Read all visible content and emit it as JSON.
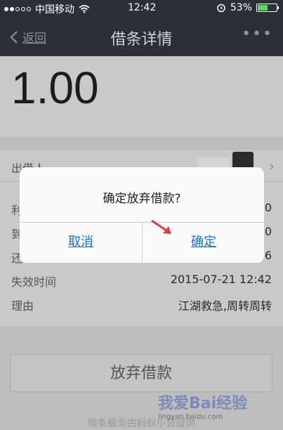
{
  "status_bar": {
    "carrier": "中国移动",
    "time": "12:42",
    "battery_percent": "53%",
    "battery_level": 0.53
  },
  "nav": {
    "back_label": "返回",
    "title": "借条详情"
  },
  "amount": "1.00",
  "details": {
    "lender_label": "出借人",
    "rows": [
      {
        "label": "利",
        "value": "0"
      },
      {
        "label": "到",
        "value": "0"
      },
      {
        "label": "还",
        "value": "6"
      },
      {
        "label": "失效时间",
        "value": "2015-07-21 12:42"
      },
      {
        "label": "理由",
        "value": "江湖救急,周转周转"
      }
    ]
  },
  "give_up_button": "放弃借款",
  "footer_note": "借条服务由蚂蚁小贷提供",
  "dialog": {
    "message": "确定放弃借款?",
    "cancel_label": "取消",
    "confirm_label": "确定"
  },
  "watermark": {
    "text": "我爱Bai经验",
    "sub": "jingyan.baidu.com"
  },
  "colors": {
    "nav_bg": "#2c2f38",
    "link_blue": "#1a6fd8",
    "arrow_red": "#e23b3b"
  }
}
